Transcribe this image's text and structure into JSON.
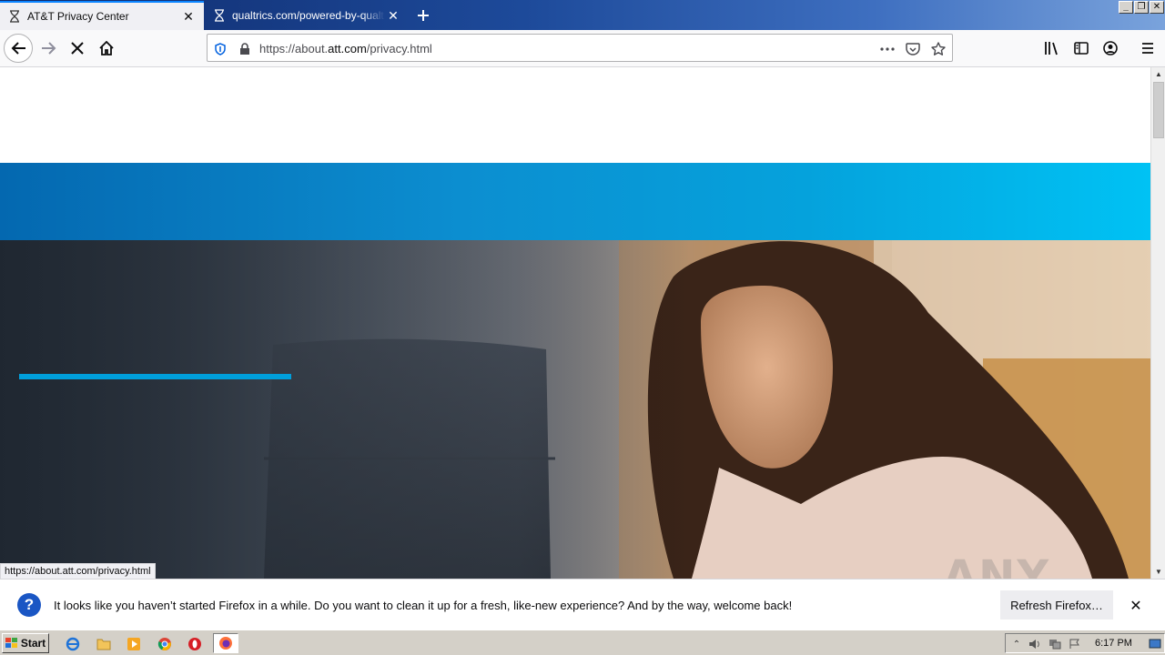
{
  "tabs": [
    {
      "title": "AT&T Privacy Center",
      "active": true
    },
    {
      "title": "qualtrics.com/powered-by-qualtrics",
      "active": false
    }
  ],
  "urlbar": {
    "url_prefix": "https://about.",
    "url_domain": "att.com",
    "url_suffix": "/privacy.html"
  },
  "status_link": "https://about.att.com/privacy.html",
  "notification": {
    "message": "It looks like you haven’t started Firefox in a while. Do you want to clean it up for a fresh, like-new experience? And by the way, welcome back!",
    "button_label": "Refresh Firefox…"
  },
  "watermark": "ANY RUN",
  "taskbar": {
    "start_label": "Start",
    "clock": "6:17 PM"
  },
  "colors": {
    "brand_blue": "#009fdb",
    "firefox_accent": "#0a84ff"
  }
}
